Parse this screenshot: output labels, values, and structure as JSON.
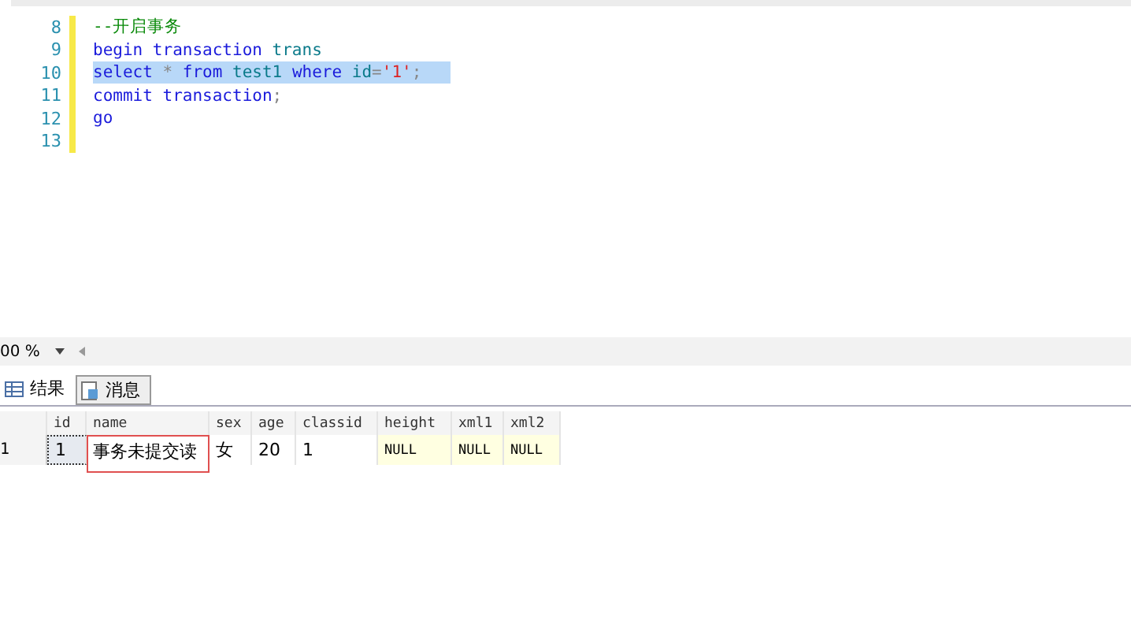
{
  "editor": {
    "lines": [
      {
        "number": "8",
        "selected": false,
        "tokens": [
          {
            "kind": "comment",
            "text": "--开启事务"
          }
        ]
      },
      {
        "number": "9",
        "selected": false,
        "tokens": [
          {
            "kind": "keyword",
            "text": "begin transaction"
          },
          {
            "kind": "plain",
            "text": " trans"
          }
        ]
      },
      {
        "number": "10",
        "selected": true,
        "tokens": [
          {
            "kind": "keyword",
            "text": "select"
          },
          {
            "kind": "operator",
            "text": " * "
          },
          {
            "kind": "keyword",
            "text": "from"
          },
          {
            "kind": "plain",
            "text": " test1 "
          },
          {
            "kind": "keyword",
            "text": "where"
          },
          {
            "kind": "plain",
            "text": " id"
          },
          {
            "kind": "operator",
            "text": "="
          },
          {
            "kind": "string",
            "text": "'1'"
          },
          {
            "kind": "operator",
            "text": ";"
          }
        ]
      },
      {
        "number": "11",
        "selected": false,
        "tokens": [
          {
            "kind": "keyword",
            "text": "commit transaction"
          },
          {
            "kind": "operator",
            "text": ";"
          }
        ]
      },
      {
        "number": "12",
        "selected": false,
        "tokens": [
          {
            "kind": "keyword",
            "text": "go"
          }
        ]
      },
      {
        "number": "13",
        "selected": false
      }
    ]
  },
  "zoom": "00 %",
  "tabs": [
    {
      "label": "结果",
      "selected": true,
      "kind": "grid"
    },
    {
      "label": "消息",
      "selected": false,
      "kind": "message"
    }
  ],
  "grid": {
    "columns": [
      "id",
      "name",
      "sex",
      "age",
      "classid",
      "height",
      "xml1",
      "xml2"
    ],
    "rows": [
      {
        "number": "1",
        "cells": [
          {
            "text": "1",
            "focused": true,
            "null": false,
            "outlined": false
          },
          {
            "text": "事务未提交读",
            "focused": false,
            "null": false,
            "outlined": true
          },
          {
            "text": "女",
            "focused": false,
            "null": false,
            "outlined": false
          },
          {
            "text": "20",
            "focused": false,
            "null": false,
            "outlined": false
          },
          {
            "text": "1",
            "focused": false,
            "null": false,
            "outlined": false
          },
          {
            "text": "NULL",
            "focused": false,
            "null": true,
            "outlined": false
          },
          {
            "text": "NULL",
            "focused": false,
            "null": true,
            "outlined": false
          },
          {
            "text": "NULL",
            "focused": false,
            "null": true,
            "outlined": false
          }
        ]
      }
    ]
  }
}
